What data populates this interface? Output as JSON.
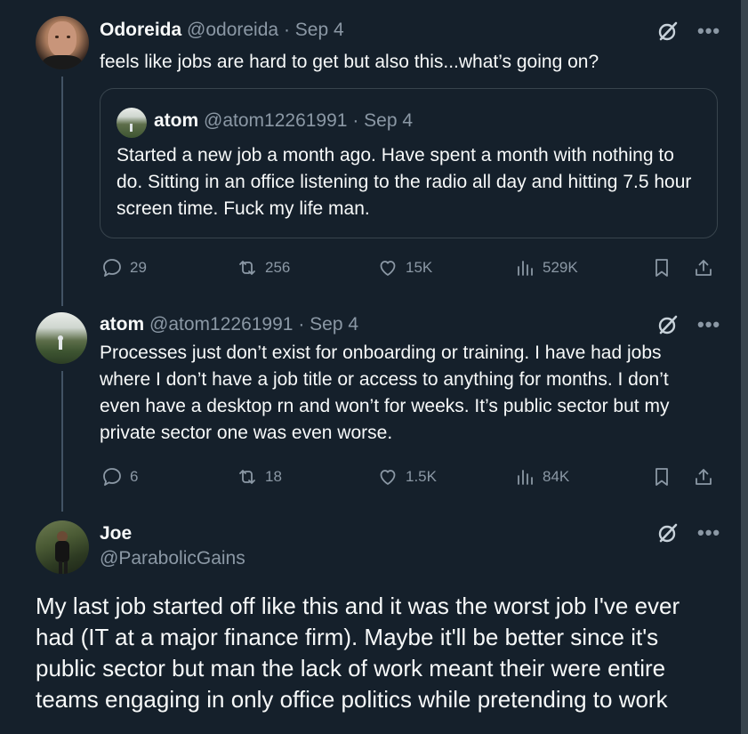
{
  "post1": {
    "name": "Odoreida",
    "handle": "@odoreida",
    "date": "· Sep 4",
    "text": "feels like jobs are hard to get but also this...what’s going on?",
    "quote": {
      "name": "atom",
      "handle": "@atom12261991",
      "date": "· Sep 4",
      "text": "Started a new job a month ago. Have spent a month with nothing to do. Sitting in an office listening to the radio all day and hitting 7.5 hour screen time. Fuck my life man."
    },
    "stats": {
      "replies": "29",
      "reposts": "256",
      "likes": "15K",
      "views": "529K"
    }
  },
  "post2": {
    "name": "atom",
    "handle": "@atom12261991",
    "date": "· Sep 4",
    "text": "Processes just don’t exist for onboarding or training. I have had jobs where I don’t have a job title or access to anything for months. I don’t even have a desktop rn and won’t for weeks. It’s public sector but my private sector one was even worse.",
    "stats": {
      "replies": "6",
      "reposts": "18",
      "likes": "1.5K",
      "views": "84K"
    }
  },
  "post3": {
    "name": "Joe",
    "handle": "@ParabolicGains",
    "text": "My last job started off like this and it was the worst job I've ever had (IT at a major finance firm). Maybe it'll be better since it's public sector but man the lack of work meant their were entire teams engaging in only office politics while pretending to work"
  },
  "more_label": "•••",
  "colors": {
    "background": "#15202b",
    "text": "#f7f9f9",
    "muted": "#8b98a5",
    "border": "#38444d"
  }
}
